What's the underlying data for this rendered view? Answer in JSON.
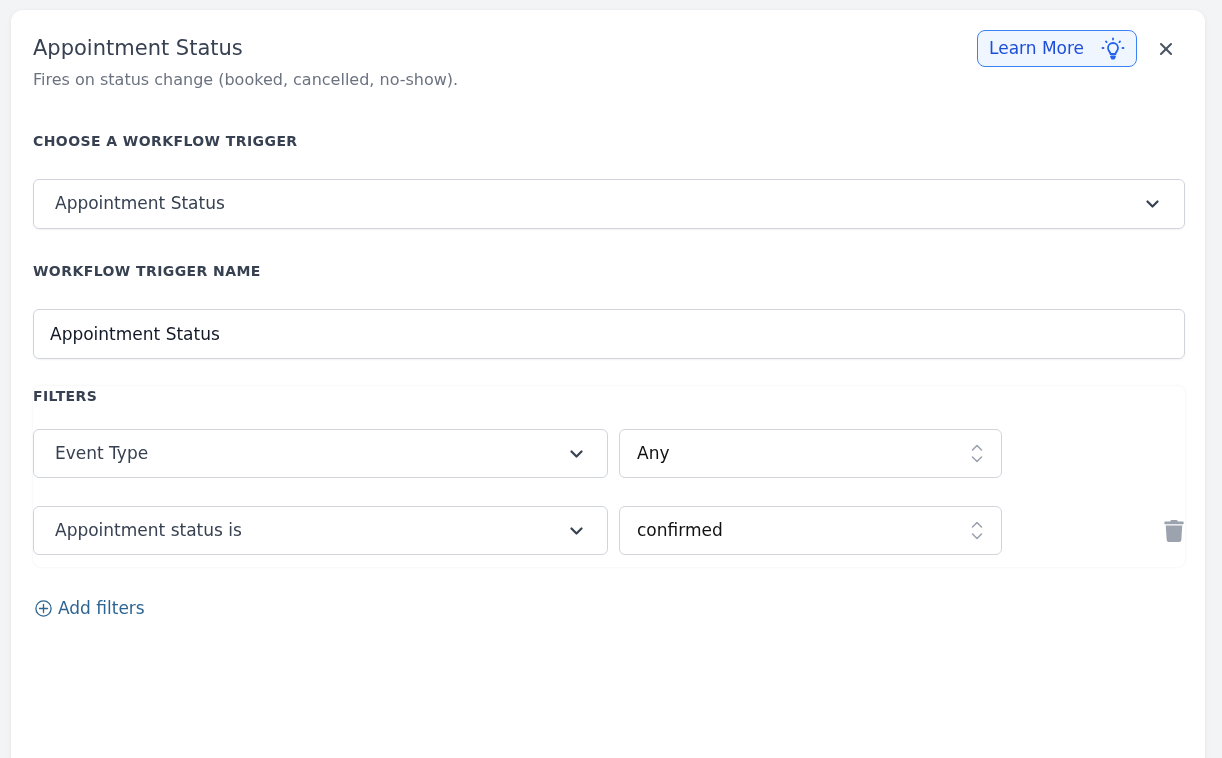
{
  "panel": {
    "title": "Appointment Status",
    "subtitle": "Fires on status change (booked, cancelled, no-show).",
    "learn_more_button": "Learn More"
  },
  "trigger_select": {
    "label": "CHOOSE A WORKFLOW TRIGGER",
    "value": "Appointment Status"
  },
  "trigger_name": {
    "label": "WORKFLOW TRIGGER NAME",
    "value": "Appointment Status"
  },
  "filters": {
    "label": "FILTERS",
    "rows": [
      {
        "field": "Event Type",
        "value": "Any",
        "deletable": false
      },
      {
        "field": "Appointment status is",
        "value": "confirmed",
        "deletable": true
      }
    ],
    "add_button": "Add filters"
  }
}
